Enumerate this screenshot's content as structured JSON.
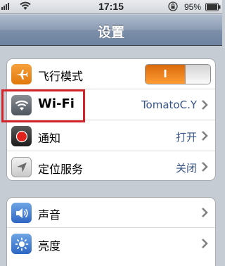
{
  "status_bar": {
    "time": "17:15",
    "battery_percent": "95%",
    "signal_icon": "signal-icon",
    "wifi_icon": "wifi-icon",
    "lock_icon": "orientation-lock-icon",
    "battery_icon": "battery-icon"
  },
  "nav": {
    "title": "设置"
  },
  "group1": [
    {
      "label": "飞行模式",
      "icon": "airplane-icon",
      "toggle_on_label": "I",
      "toggle_state": "on"
    },
    {
      "label": "Wi-Fi",
      "icon": "wifi-icon",
      "value": "TomatoC.Y"
    },
    {
      "label": "通知",
      "icon": "notifications-icon",
      "value": "打开"
    },
    {
      "label": "定位服务",
      "icon": "location-icon",
      "value": "关闭"
    }
  ],
  "group2": [
    {
      "label": "声音",
      "icon": "sound-icon"
    },
    {
      "label": "亮度",
      "icon": "brightness-icon"
    }
  ],
  "colors": {
    "toggle_on": "#f7861c",
    "highlight": "#d2232a",
    "value_text": "#385487",
    "background": "#c5ccd4"
  }
}
